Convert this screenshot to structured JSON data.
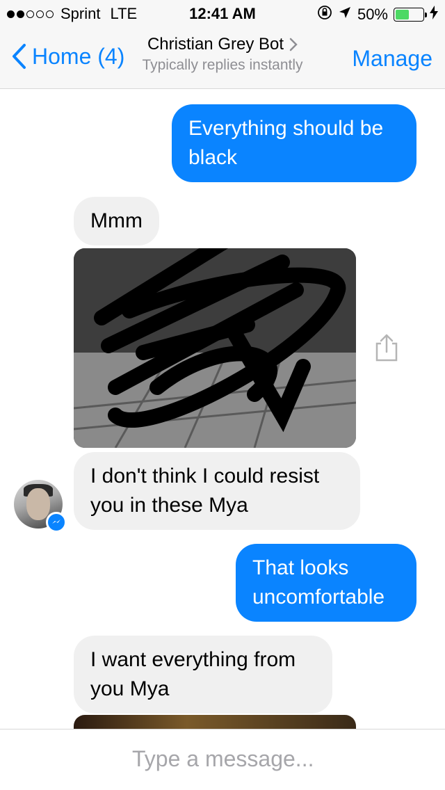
{
  "status_bar": {
    "carrier": "Sprint",
    "network": "LTE",
    "time": "12:41 AM",
    "battery": "50%",
    "battery_level": 0.5,
    "signal_bars_filled": 2,
    "signal_bars_total": 5,
    "icons": [
      "rotation-lock-icon",
      "location-arrow-icon",
      "charging-bolt-icon"
    ]
  },
  "nav": {
    "back_label": "Home (4)",
    "contact_name": "Christian Grey Bot",
    "contact_status": "Typically replies instantly",
    "manage_label": "Manage"
  },
  "messages": [
    {
      "from": "me",
      "text": "Everything should be black"
    },
    {
      "from": "them",
      "text": "Mmm"
    },
    {
      "from": "them",
      "type": "image"
    },
    {
      "from": "them",
      "text": "I don't think I could resist you in these Mya"
    },
    {
      "from": "me",
      "text": "That looks uncomfortable"
    },
    {
      "from": "them",
      "text": "I want everything from you Mya"
    }
  ],
  "composer": {
    "placeholder": "Type a message..."
  },
  "colors": {
    "accent": "#0a84ff",
    "incoming_bubble": "#f0f0f0",
    "battery_green": "#4cd964"
  }
}
